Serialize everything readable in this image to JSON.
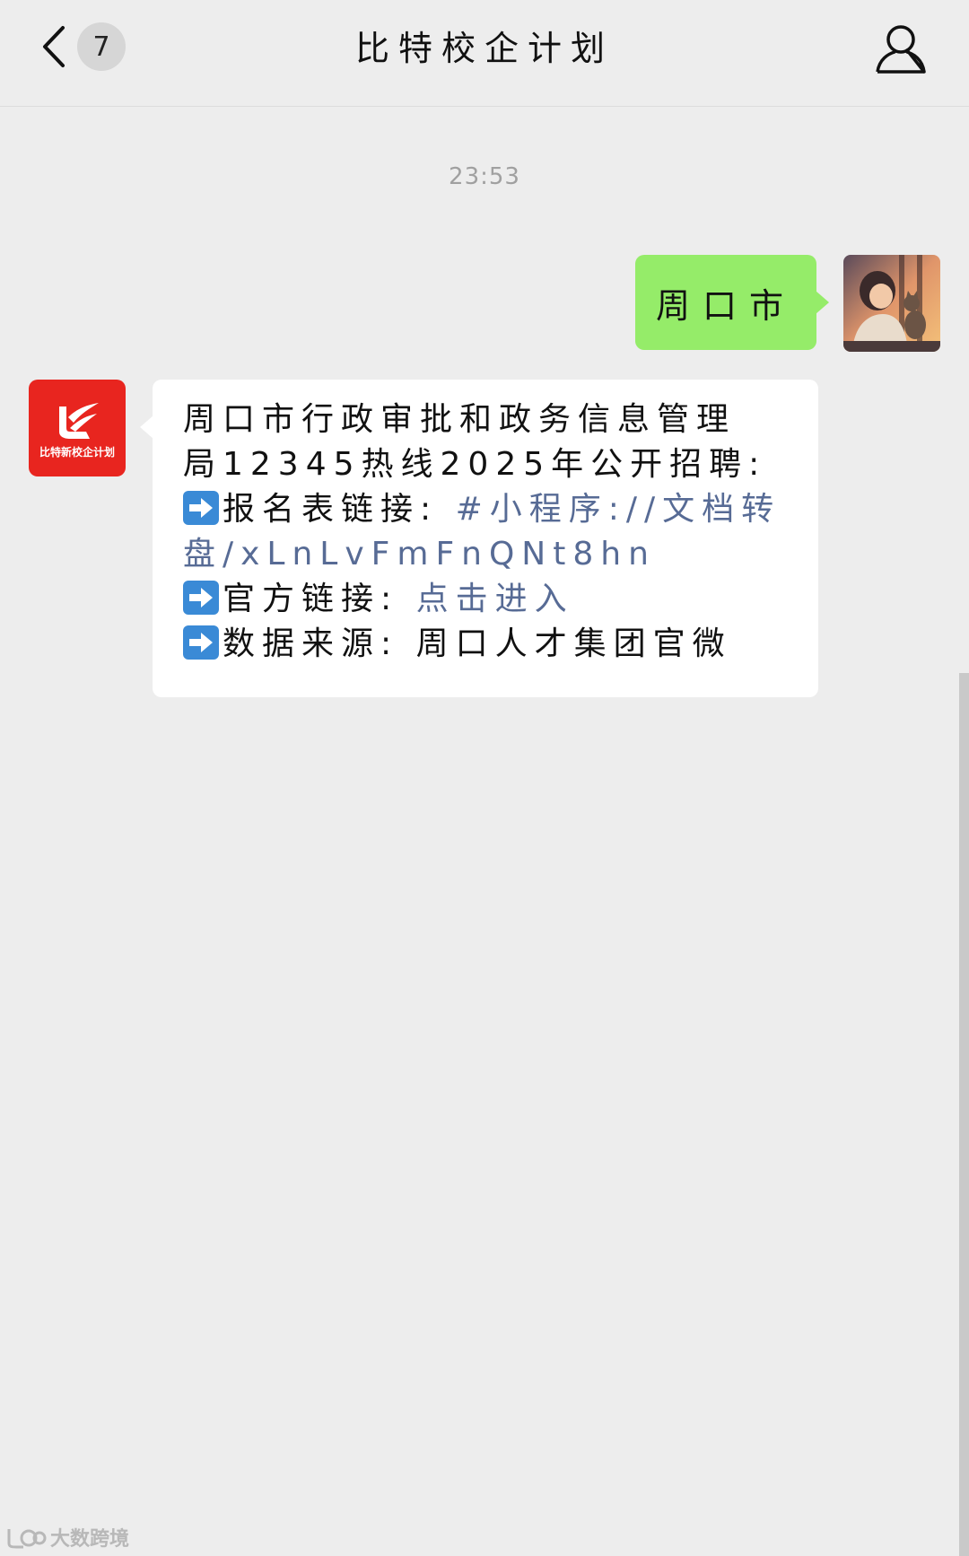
{
  "header": {
    "unread_count": "7",
    "title": "比特校企计划"
  },
  "timestamp": "23:53",
  "outgoing": {
    "text": "周口市"
  },
  "incoming": {
    "avatar_text": "比特新校企计划",
    "line1": "周口市行政审批和政务信息管理",
    "line2": "局12345热线2025年公开招聘:",
    "line3_label": "报名表链接: ",
    "line3_link": "#小程序://文档转",
    "line4_link": "盘/xLnLvFmFnQNt8hn",
    "line5_label": "官方链接: ",
    "line5_link": "点击进入",
    "line6_label": "数据来源: ",
    "line6_value": "周口人才集团官微"
  },
  "watermark": "大数跨境",
  "colors": {
    "background": "#ededed",
    "outgoing_bubble": "#95ec69",
    "incoming_bubble": "#ffffff",
    "link": "#576b95",
    "avatar_red": "#e8251f"
  }
}
